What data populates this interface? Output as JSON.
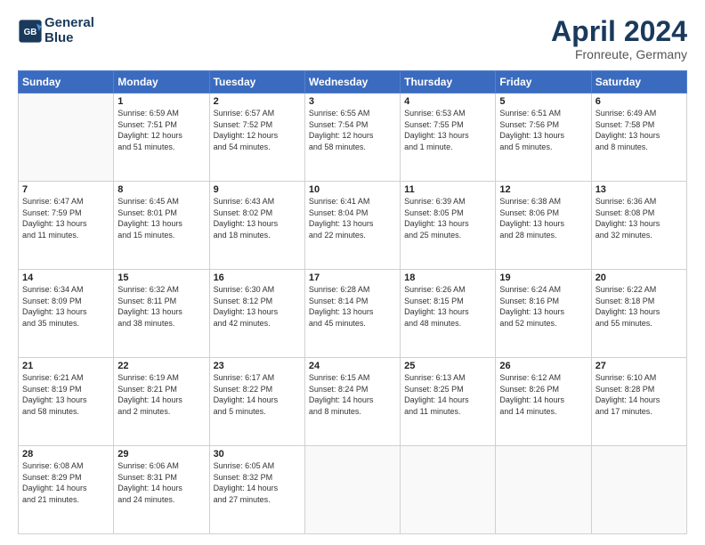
{
  "header": {
    "logo_line1": "General",
    "logo_line2": "Blue",
    "month": "April 2024",
    "location": "Fronreute, Germany"
  },
  "weekdays": [
    "Sunday",
    "Monday",
    "Tuesday",
    "Wednesday",
    "Thursday",
    "Friday",
    "Saturday"
  ],
  "weeks": [
    [
      {
        "num": "",
        "info": ""
      },
      {
        "num": "1",
        "info": "Sunrise: 6:59 AM\nSunset: 7:51 PM\nDaylight: 12 hours\nand 51 minutes."
      },
      {
        "num": "2",
        "info": "Sunrise: 6:57 AM\nSunset: 7:52 PM\nDaylight: 12 hours\nand 54 minutes."
      },
      {
        "num": "3",
        "info": "Sunrise: 6:55 AM\nSunset: 7:54 PM\nDaylight: 12 hours\nand 58 minutes."
      },
      {
        "num": "4",
        "info": "Sunrise: 6:53 AM\nSunset: 7:55 PM\nDaylight: 13 hours\nand 1 minute."
      },
      {
        "num": "5",
        "info": "Sunrise: 6:51 AM\nSunset: 7:56 PM\nDaylight: 13 hours\nand 5 minutes."
      },
      {
        "num": "6",
        "info": "Sunrise: 6:49 AM\nSunset: 7:58 PM\nDaylight: 13 hours\nand 8 minutes."
      }
    ],
    [
      {
        "num": "7",
        "info": "Sunrise: 6:47 AM\nSunset: 7:59 PM\nDaylight: 13 hours\nand 11 minutes."
      },
      {
        "num": "8",
        "info": "Sunrise: 6:45 AM\nSunset: 8:01 PM\nDaylight: 13 hours\nand 15 minutes."
      },
      {
        "num": "9",
        "info": "Sunrise: 6:43 AM\nSunset: 8:02 PM\nDaylight: 13 hours\nand 18 minutes."
      },
      {
        "num": "10",
        "info": "Sunrise: 6:41 AM\nSunset: 8:04 PM\nDaylight: 13 hours\nand 22 minutes."
      },
      {
        "num": "11",
        "info": "Sunrise: 6:39 AM\nSunset: 8:05 PM\nDaylight: 13 hours\nand 25 minutes."
      },
      {
        "num": "12",
        "info": "Sunrise: 6:38 AM\nSunset: 8:06 PM\nDaylight: 13 hours\nand 28 minutes."
      },
      {
        "num": "13",
        "info": "Sunrise: 6:36 AM\nSunset: 8:08 PM\nDaylight: 13 hours\nand 32 minutes."
      }
    ],
    [
      {
        "num": "14",
        "info": "Sunrise: 6:34 AM\nSunset: 8:09 PM\nDaylight: 13 hours\nand 35 minutes."
      },
      {
        "num": "15",
        "info": "Sunrise: 6:32 AM\nSunset: 8:11 PM\nDaylight: 13 hours\nand 38 minutes."
      },
      {
        "num": "16",
        "info": "Sunrise: 6:30 AM\nSunset: 8:12 PM\nDaylight: 13 hours\nand 42 minutes."
      },
      {
        "num": "17",
        "info": "Sunrise: 6:28 AM\nSunset: 8:14 PM\nDaylight: 13 hours\nand 45 minutes."
      },
      {
        "num": "18",
        "info": "Sunrise: 6:26 AM\nSunset: 8:15 PM\nDaylight: 13 hours\nand 48 minutes."
      },
      {
        "num": "19",
        "info": "Sunrise: 6:24 AM\nSunset: 8:16 PM\nDaylight: 13 hours\nand 52 minutes."
      },
      {
        "num": "20",
        "info": "Sunrise: 6:22 AM\nSunset: 8:18 PM\nDaylight: 13 hours\nand 55 minutes."
      }
    ],
    [
      {
        "num": "21",
        "info": "Sunrise: 6:21 AM\nSunset: 8:19 PM\nDaylight: 13 hours\nand 58 minutes."
      },
      {
        "num": "22",
        "info": "Sunrise: 6:19 AM\nSunset: 8:21 PM\nDaylight: 14 hours\nand 2 minutes."
      },
      {
        "num": "23",
        "info": "Sunrise: 6:17 AM\nSunset: 8:22 PM\nDaylight: 14 hours\nand 5 minutes."
      },
      {
        "num": "24",
        "info": "Sunrise: 6:15 AM\nSunset: 8:24 PM\nDaylight: 14 hours\nand 8 minutes."
      },
      {
        "num": "25",
        "info": "Sunrise: 6:13 AM\nSunset: 8:25 PM\nDaylight: 14 hours\nand 11 minutes."
      },
      {
        "num": "26",
        "info": "Sunrise: 6:12 AM\nSunset: 8:26 PM\nDaylight: 14 hours\nand 14 minutes."
      },
      {
        "num": "27",
        "info": "Sunrise: 6:10 AM\nSunset: 8:28 PM\nDaylight: 14 hours\nand 17 minutes."
      }
    ],
    [
      {
        "num": "28",
        "info": "Sunrise: 6:08 AM\nSunset: 8:29 PM\nDaylight: 14 hours\nand 21 minutes."
      },
      {
        "num": "29",
        "info": "Sunrise: 6:06 AM\nSunset: 8:31 PM\nDaylight: 14 hours\nand 24 minutes."
      },
      {
        "num": "30",
        "info": "Sunrise: 6:05 AM\nSunset: 8:32 PM\nDaylight: 14 hours\nand 27 minutes."
      },
      {
        "num": "",
        "info": ""
      },
      {
        "num": "",
        "info": ""
      },
      {
        "num": "",
        "info": ""
      },
      {
        "num": "",
        "info": ""
      }
    ]
  ]
}
